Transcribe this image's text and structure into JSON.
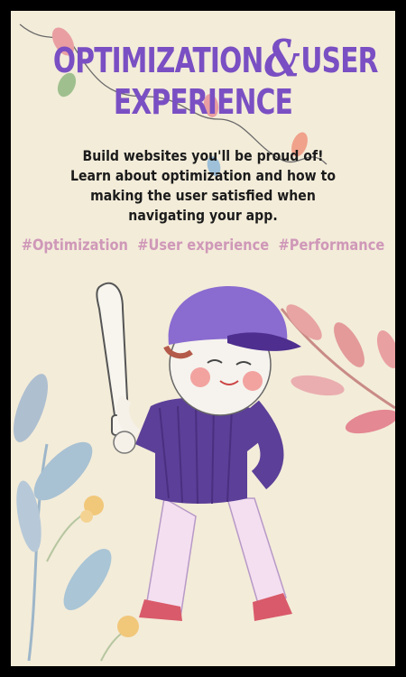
{
  "poster": {
    "title_line1_part1": "OPTIMIZATION",
    "title_ampersand": "&",
    "title_line1_part2": "USER",
    "title_line2": "EXPERIENCE",
    "subtitle": "Build websites you'll be proud of! Learn about optimization and how to making the user satisfied when navigating your app.",
    "hashtags": [
      "#Optimization",
      "#User experience",
      "#Performance"
    ]
  },
  "colors": {
    "background": "#f3ecd9",
    "frame": "#000000",
    "title": "#7a4fc3",
    "hashtag": "#cf98b8",
    "text": "#1b1b1b"
  },
  "illustration": {
    "subject": "child-baseball-player-with-bat",
    "decor": [
      "string-lights",
      "leaf-branches",
      "berry-sprigs"
    ]
  }
}
